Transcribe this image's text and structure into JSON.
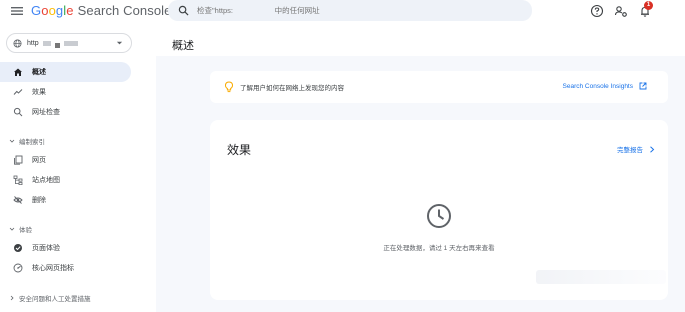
{
  "header": {
    "logo_letters": [
      "G",
      "o",
      "o",
      "g",
      "l",
      "e"
    ],
    "product": "Search Console",
    "search_placeholder": "检查\"https:                    中的任何网址",
    "notification_count": "1"
  },
  "sidebar": {
    "property_label": "http",
    "items_top": [
      {
        "label": "概述",
        "icon": "home-icon",
        "active": true
      },
      {
        "label": "效果",
        "icon": "trending-icon",
        "active": false
      },
      {
        "label": "网址检查",
        "icon": "search-icon",
        "active": false
      }
    ],
    "section_index": "编制索引",
    "items_index": [
      {
        "label": "网页",
        "icon": "pages-icon"
      },
      {
        "label": "站点地图",
        "icon": "sitemap-icon"
      },
      {
        "label": "删除",
        "icon": "removal-icon"
      }
    ],
    "section_experience": "体验",
    "items_experience": [
      {
        "label": "页面体验",
        "icon": "page-experience-icon"
      },
      {
        "label": "核心网页指标",
        "icon": "core-vitals-icon"
      }
    ],
    "section_security": "安全问题和人工处置措施"
  },
  "main": {
    "page_title": "概述",
    "insights": {
      "message": "了解用户如何在网络上发现您的内容",
      "link_label": "Search Console Insights"
    },
    "performance": {
      "title": "效果",
      "full_report_label": "完整报告",
      "processing_text": "正在处理数据，请过 1 天左右再来查看"
    }
  },
  "colors": {
    "accent": "#1a73e8",
    "active_nav_bg": "#e8eef9",
    "main_bg": "#f6f8fc",
    "search_bg": "#eef2f8",
    "bulb": "#f9ab00",
    "badge": "#d93025"
  }
}
